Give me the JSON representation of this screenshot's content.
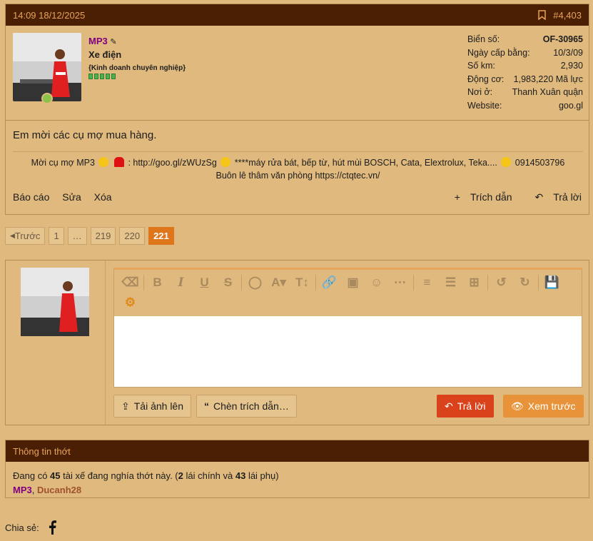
{
  "post": {
    "datetime": "14:09 18/12/2025",
    "post_number": "#4,403",
    "user": {
      "name": "MP3",
      "title": "Xe điện",
      "banner": "{Kinh doanh chuyên nghiệp}"
    },
    "stats": [
      {
        "label": "Biển số:",
        "value": "OF-30965"
      },
      {
        "label": "Ngày cấp bằng:",
        "value": "10/3/09"
      },
      {
        "label": "Số km:",
        "value": "2,930"
      },
      {
        "label": "Động cơ:",
        "value": "1,983,220 Mã lực"
      },
      {
        "label": "Nơi ở:",
        "value": "Thanh Xuân quận"
      },
      {
        "label": "Website:",
        "value": "goo.gl"
      }
    ],
    "message": "Em mời các cụ mợ mua hàng.",
    "signature": {
      "part1": "Mời cụ mợ MP3",
      "part2": ": http://goo.gl/zWUzSg",
      "part3": "****máy rửa bát, bếp từ, hút mùi BOSCH, Cata, Elextrolux, Teka....",
      "part4": "0914503796",
      "line2": "Buôn lê thâm văn phòng https://ctqtec.vn/"
    },
    "actions": {
      "report": "Báo cáo",
      "edit": "Sửa",
      "delete": "Xóa",
      "quote": "Trích dẫn",
      "reply": "Trả lời"
    }
  },
  "pagination": {
    "prev": "Trước",
    "pages": [
      "1",
      "…",
      "219",
      "220",
      "221"
    ],
    "current": "221"
  },
  "reply_box": {
    "upload": "Tải ảnh lên",
    "insert_quote": "Chèn trích dẫn…",
    "reply": "Trả lời",
    "preview": "Xem trước"
  },
  "thread_info": {
    "header": "Thông tin thớt",
    "text_prefix": "Đang có ",
    "count": "45",
    "text_mid": " tài xế đang nghía thớt này. (",
    "drivers": "2",
    "text_mid2": " lái chính và ",
    "passengers": "43",
    "text_suffix": " lái phụ)",
    "users": [
      "MP3",
      "Ducanh28"
    ]
  },
  "share": {
    "label": "Chia sẻ:"
  },
  "colors": {
    "header_bg": "#4a1f04",
    "accent": "#e0761c",
    "page_bg": "#dfb97d"
  }
}
